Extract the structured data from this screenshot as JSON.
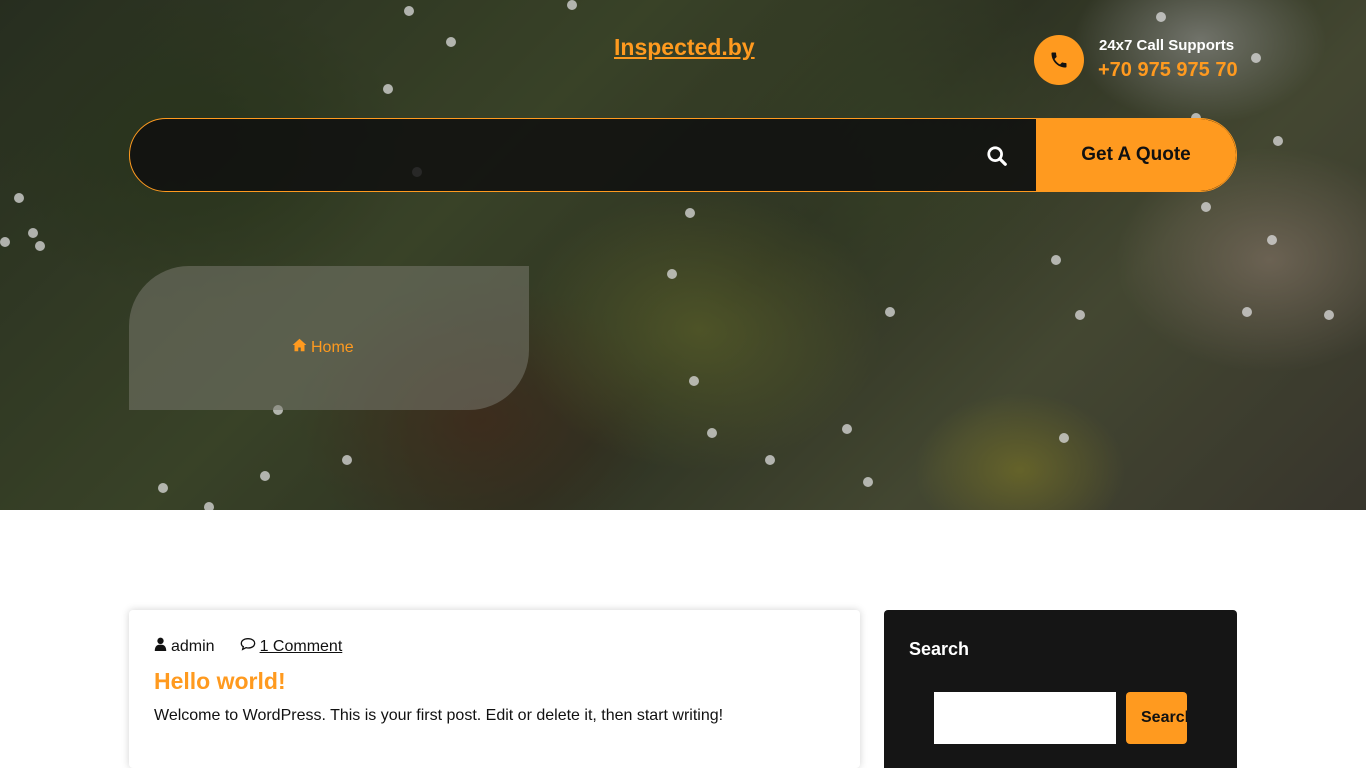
{
  "header": {
    "site_title": "Inspected.by",
    "support_label": "24x7 Call Supports",
    "support_phone": "+70 975 975 70",
    "search_placeholder": "",
    "quote_label": "Get A Quote"
  },
  "breadcrumb": {
    "home_label": "Home"
  },
  "post": {
    "author": "admin",
    "comments": "1 Comment",
    "title": "Hello world!",
    "excerpt": "Welcome to WordPress. This is your first post. Edit or delete it, then start writing!"
  },
  "sidebar": {
    "search_title": "Search",
    "search_value": "",
    "search_button": "Search"
  },
  "colors": {
    "accent": "#ff9a1f",
    "dark": "#151515"
  },
  "icons": {
    "phone": "phone-icon",
    "search": "search-icon",
    "home": "home-icon",
    "user": "user-icon",
    "comment": "comment-icon"
  }
}
